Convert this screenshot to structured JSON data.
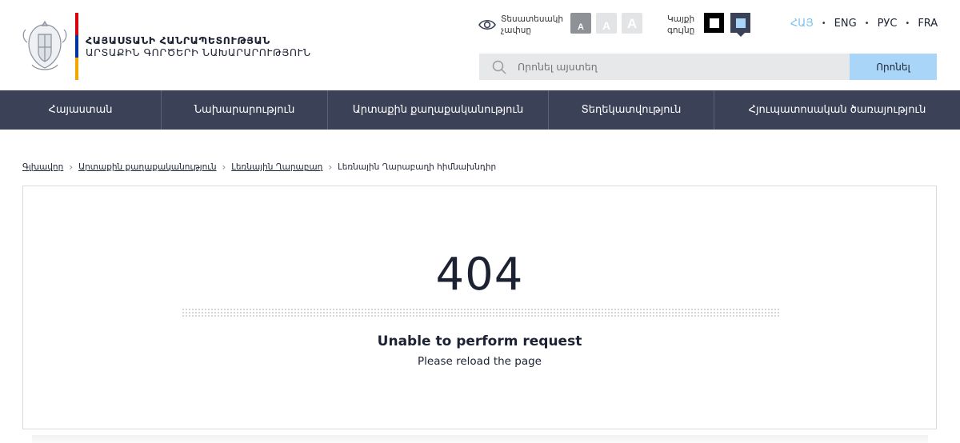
{
  "header": {
    "logo_line1": "ՀԱՅԱՍՏԱՆԻ ՀԱՆՐԱՊԵՏՈՒԹՅԱՆ",
    "logo_line2": "ԱՐՏԱՔԻՆ ԳՈՐԾԵՐԻ ՆԱԽԱՐԱՐՈՒԹՅՈՒՆ",
    "flag_colors": [
      "#d90012",
      "#0033a0",
      "#f2a800"
    ],
    "vision_label_1": "Տեսատեսակի",
    "vision_label_2": "չափսը",
    "font_sizes": [
      "A",
      "A",
      "A"
    ],
    "contrast_label_1": "Կայքի",
    "contrast_label_2": "գույնը",
    "languages": [
      "ՀԱՅ",
      "ENG",
      "РУС",
      "FRA"
    ],
    "active_language": "ՀԱՅ",
    "search_placeholder": "Որոնել այստեղ",
    "search_button": "Որոնել"
  },
  "nav": {
    "items": [
      "Հայաստան",
      "Նախարարություն",
      "Արտաքին քաղաքականություն",
      "Տեղեկատվություն",
      "Հյուպատոսական ծառայություն"
    ]
  },
  "breadcrumb": {
    "items": [
      "Գլխավոր",
      "Արտաքին քաղաքականություն",
      "Լեռնային Ղարաբաղ",
      "Լեռնային Ղարաբաղի հիմնախնդիր"
    ]
  },
  "error": {
    "code": "404",
    "title": "Unable to perform request",
    "subtitle": "Please reload the page"
  },
  "colors": {
    "nav_bg": "#3b4157",
    "accent_light_blue": "#a9d6f8",
    "active_lang": "#7cc0ee"
  }
}
